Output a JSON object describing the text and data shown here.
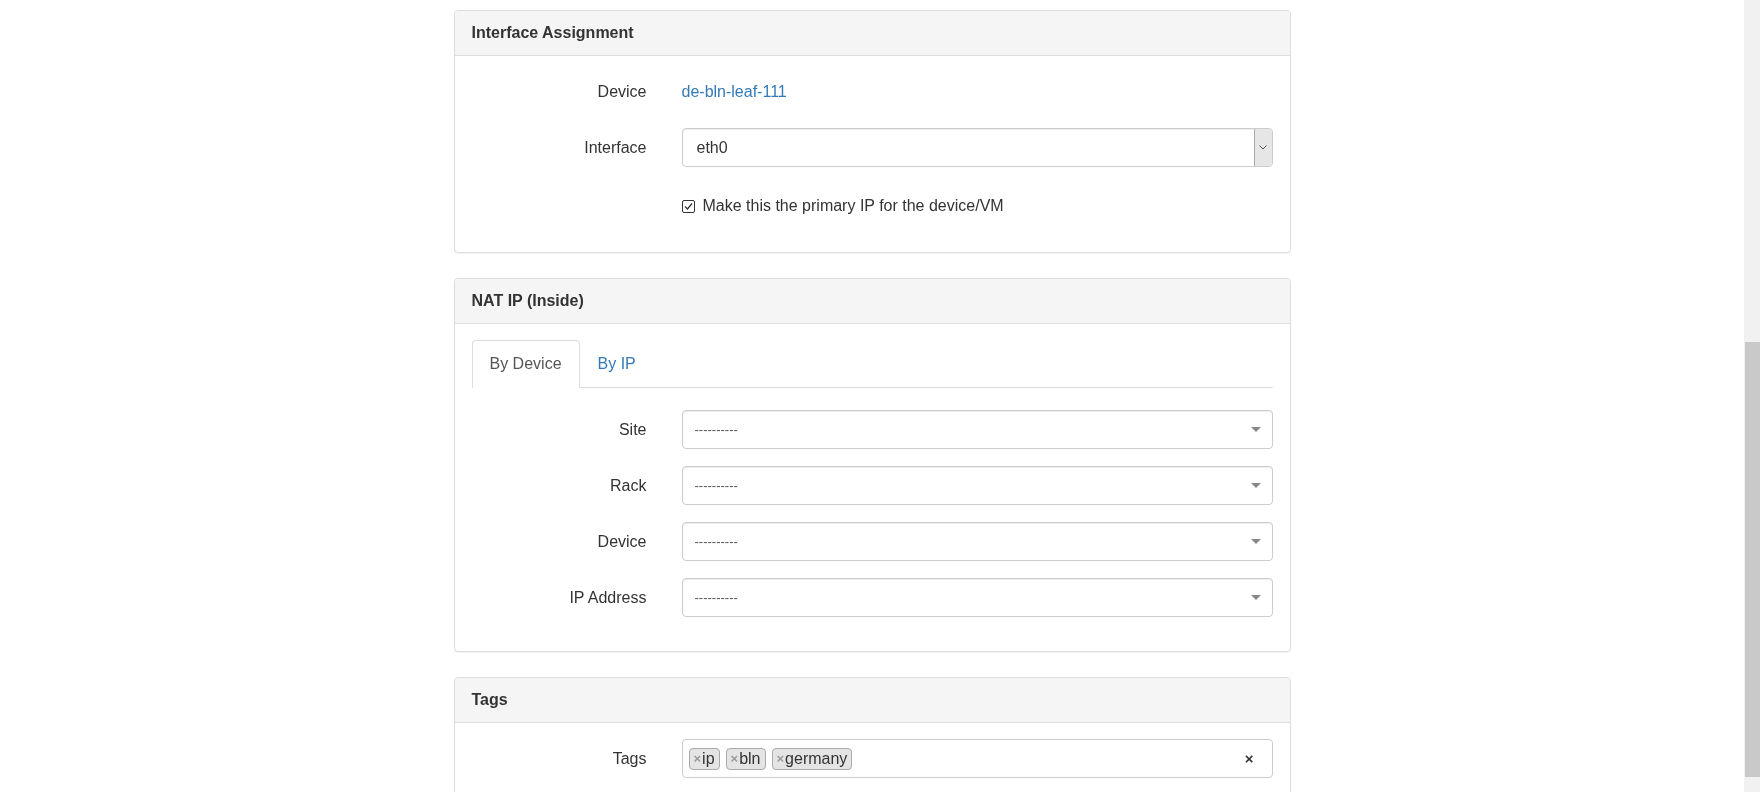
{
  "panels": [
    {
      "title": "Interface Assignment",
      "rows": [
        {
          "kind": "link",
          "label": "Device",
          "value": "de-bln-leaf-111"
        },
        {
          "kind": "native-select",
          "label": "Interface",
          "value": "eth0"
        },
        {
          "kind": "checkbox",
          "text": "Make this the primary IP for the device/VM",
          "checked": true
        }
      ]
    },
    {
      "title": "NAT IP (Inside)",
      "tabs": [
        {
          "label": "By Device",
          "selected": true
        },
        {
          "label": "By IP",
          "selected": false
        }
      ],
      "rows": [
        {
          "kind": "select",
          "label": "Site",
          "value": "----------"
        },
        {
          "kind": "select",
          "label": "Rack",
          "value": "----------"
        },
        {
          "kind": "select",
          "label": "Device",
          "value": "----------"
        },
        {
          "kind": "select",
          "label": "IP Address",
          "value": "----------"
        }
      ]
    },
    {
      "title": "Tags",
      "rows": [
        {
          "kind": "tags",
          "label": "Tags",
          "tags": [
            {
              "label": "ip",
              "remove": "×"
            },
            {
              "label": "bln",
              "remove": "×"
            },
            {
              "label": "germany",
              "remove": "×"
            }
          ],
          "clear": "×"
        }
      ]
    }
  ]
}
